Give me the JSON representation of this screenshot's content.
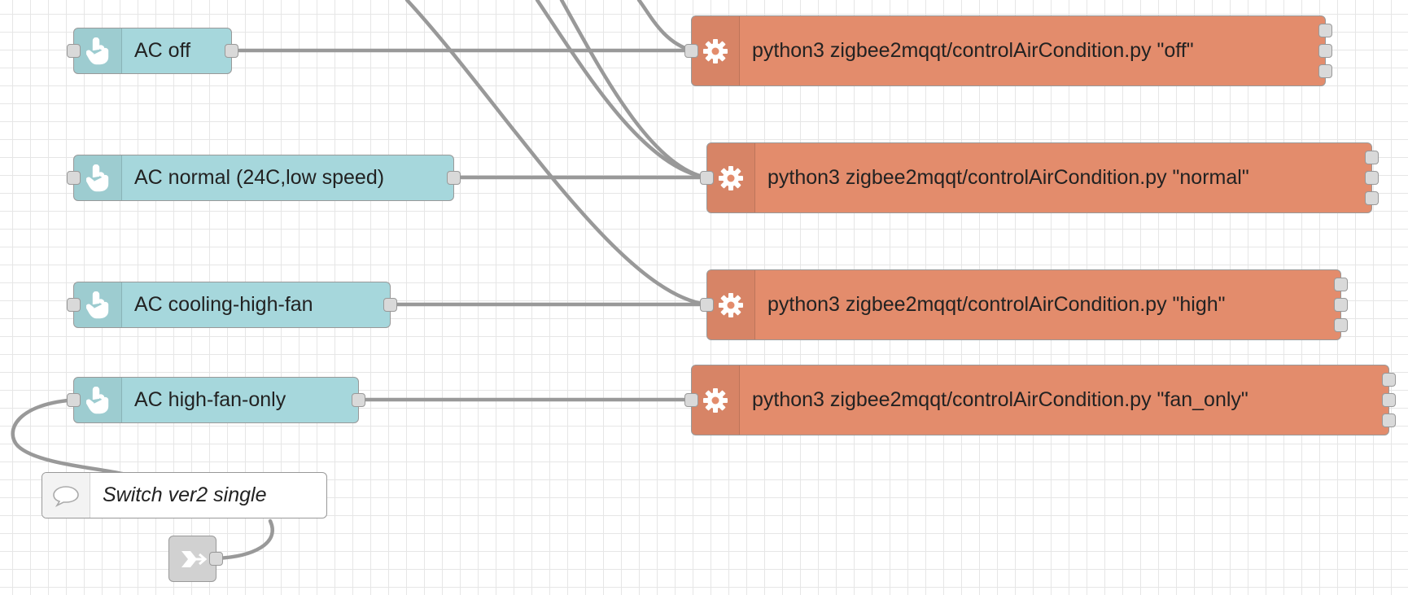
{
  "inject_nodes": [
    {
      "label": "AC off"
    },
    {
      "label": "AC normal (24C,low speed)"
    },
    {
      "label": "AC cooling-high-fan"
    },
    {
      "label": "AC high-fan-only"
    }
  ],
  "exec_nodes": [
    {
      "label": "python3 zigbee2mqqt/controlAirCondition.py \"off\""
    },
    {
      "label": "python3 zigbee2mqqt/controlAirCondition.py \"normal\""
    },
    {
      "label": "python3 zigbee2mqqt/controlAirCondition.py \"high\""
    },
    {
      "label": "python3 zigbee2mqqt/controlAirCondition.py \"fan_only\""
    }
  ],
  "comment_node": {
    "label": "Switch ver2 single"
  },
  "icons": {
    "inject": "hand-pointer-icon",
    "exec": "gear-icon",
    "comment": "speech-bubble-icon",
    "link_out": "link-out-arrow-icon"
  },
  "colors": {
    "inject_node": "#a6d7dc",
    "exec_node": "#e38c6c",
    "link_node": "#dddddd",
    "wire": "#999999",
    "grid": "#e6e6e6"
  }
}
